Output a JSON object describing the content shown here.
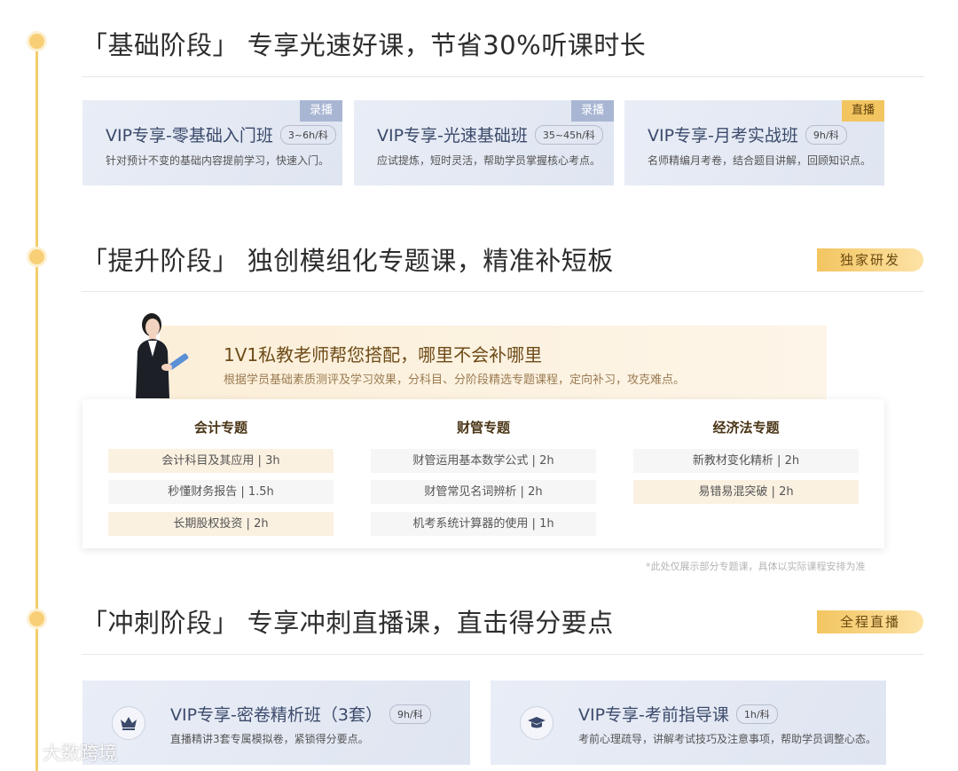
{
  "sections": {
    "basic": {
      "title_pre": "「基础阶段」 专享光速好课，",
      "title_hl": "节省30%听课时长",
      "cards": [
        {
          "title": "VIP专享-零基础入门班",
          "hours": "3~6h/科",
          "desc": "针对预计不变的基础内容提前学习，快速入门。",
          "tag": "录播"
        },
        {
          "title": "VIP专享-光速基础班",
          "hours": "35~45h/科",
          "desc": "应试提炼，短时灵活，帮助学员掌握核心考点。",
          "tag": "录播"
        },
        {
          "title": "VIP专享-月考实战班",
          "hours": "9h/科",
          "desc": "名师精编月考卷，结合题目讲解，回顾知识点。",
          "tag": "直播"
        }
      ]
    },
    "improve": {
      "title_pre": "「提升阶段」 独创模组化专题课，精准",
      "title_hl": "补短板",
      "badge": "独家研发",
      "banner_head": "1V1私教老师帮您搭配，哪里不会补哪里",
      "banner_sub": "根据学员基础素质测评及学习效果，分科目、分阶段精选专题课程，定向补习，攻克难点。",
      "columns": [
        {
          "title": "会计专题",
          "items": [
            "会计科目及其应用 | 3h",
            "秒懂财务报告 | 1.5h",
            "长期股权投资 | 2h"
          ]
        },
        {
          "title": "财管专题",
          "items": [
            "财管运用基本数学公式 | 2h",
            "财管常见名词辨析 | 2h",
            "机考系统计算器的使用 | 1h"
          ]
        },
        {
          "title": "经济法专题",
          "items": [
            "新教材变化精析 | 2h",
            "易错易混突破 | 2h"
          ]
        }
      ],
      "note": "*此处仅展示部分专题课，具体以实际课程安排为准"
    },
    "sprint": {
      "title_pre": "「冲刺阶段」 专享",
      "title_hl": "冲刺直播",
      "title_post": "课，直击得分要点",
      "badge": "全程直播",
      "cards": [
        {
          "title": "VIP专享-密卷精析班（3套）",
          "hours": "9h/科",
          "desc": "直播精讲3套专属模拟卷，紧锁得分要点。",
          "icon": "crown-icon"
        },
        {
          "title": "VIP专享-考前指导课",
          "hours": "1h/科",
          "desc": "考前心理疏导，讲解考试技巧及注意事项，帮助学员调整心态。",
          "icon": "graduation-cap-icon"
        }
      ]
    }
  },
  "watermark": "大数跨境",
  "colors": {
    "accent": "#f3c561",
    "card_bg": "#e4e9f3",
    "title_blue": "#3b4a6b"
  }
}
